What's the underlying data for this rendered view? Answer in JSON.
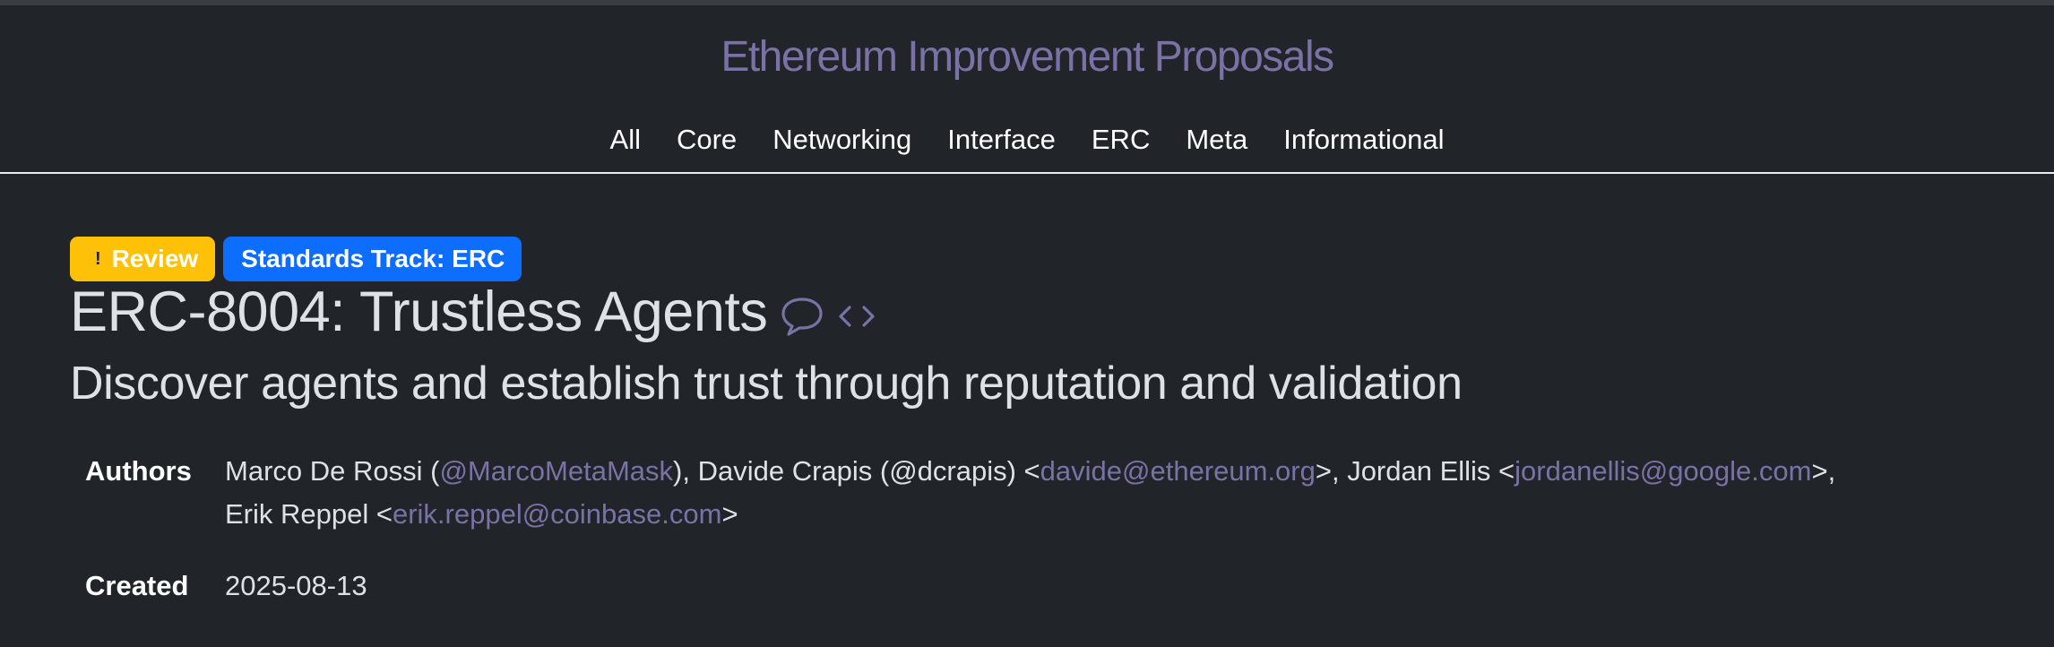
{
  "site": {
    "title": "Ethereum Improvement Proposals"
  },
  "nav": {
    "items": [
      {
        "label": "All"
      },
      {
        "label": "Core"
      },
      {
        "label": "Networking"
      },
      {
        "label": "Interface"
      },
      {
        "label": "ERC"
      },
      {
        "label": "Meta"
      },
      {
        "label": "Informational"
      }
    ]
  },
  "proposal": {
    "status_icon": "!",
    "status": "Review",
    "track": "Standards Track: ERC",
    "title": "ERC-8004: Trustless Agents",
    "subtitle": "Discover agents and establish trust through reputation and validation",
    "icons": [
      "discussion-icon",
      "source-code-icon"
    ]
  },
  "meta": {
    "authors_label": "Authors",
    "created_label": "Created",
    "created": "2025-08-13",
    "authors": {
      "a1_name": "Marco De Rossi (",
      "a1_handle": "@MarcoMetaMask",
      "a1_tail": "), Davide Crapis (@dcrapis) <",
      "a2_email": "davide@ethereum.org",
      "a2_tail": ">, Jordan Ellis <",
      "a3_email": "jordanellis@google.com",
      "a3_tail": ">,",
      "a4_name": "Erik Reppel <",
      "a4_email": "erik.reppel@coinbase.com",
      "a4_tail": ">"
    }
  },
  "colors": {
    "background": "#212529",
    "link": "#7a71a6",
    "review_badge": "#ffc107",
    "track_badge": "#0d6efd"
  }
}
